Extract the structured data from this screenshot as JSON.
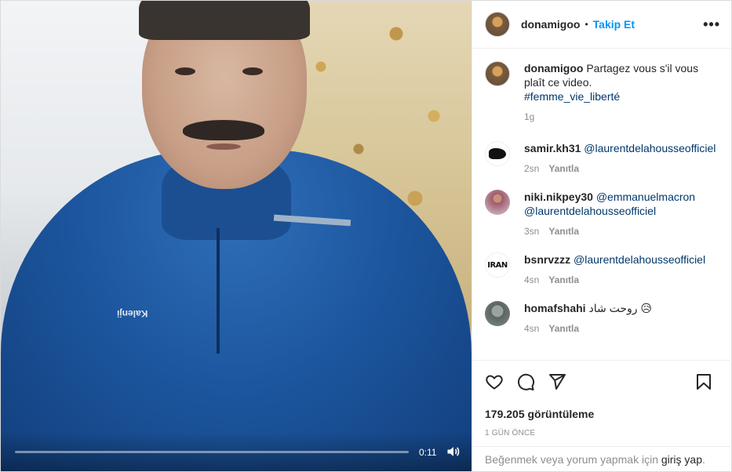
{
  "video": {
    "time": "0:11",
    "progress": 0.0,
    "volume_icon": "speaker-icon",
    "logo_text": "Kalenji"
  },
  "header": {
    "username": "donamigoo",
    "separator": "•",
    "follow_label": "Takip Et",
    "more_label": "•••"
  },
  "caption": {
    "username": "donamigoo",
    "text_line1": "Partagez vous s'il vous",
    "text_line2": "plaît ce video.",
    "hashtag": "#femme_vie_liberté",
    "time": "1g"
  },
  "comments": [
    {
      "username": "samir.kh31",
      "mention": "@laurentdelahousseofficiel",
      "text": "",
      "time": "2sn",
      "reply": "Yanıtla"
    },
    {
      "username": "niki.nikpey30",
      "mention": "@emmanuelmacron",
      "mention2": "@laurentdelahousseofficiel",
      "time": "3sn",
      "reply": "Yanıtla"
    },
    {
      "username": "bsnrvzzz",
      "mention": "@laurentdelahousseofficiel",
      "avatar_text": "IRAN",
      "time": "4sn",
      "reply": "Yanıtla"
    },
    {
      "username": "homafshahi",
      "text": "روحت شاد 😥",
      "time": "4sn",
      "reply": "Yanıtla"
    }
  ],
  "actions": {
    "views": "179.205 görüntüleme",
    "date": "1 GÜN ÖNCE",
    "icons": [
      "heart-icon",
      "comment-icon",
      "share-icon",
      "bookmark-icon"
    ]
  },
  "login": {
    "prefix": "Beğenmek veya yorum yapmak için ",
    "link": "giriş yap",
    "suffix": "."
  }
}
